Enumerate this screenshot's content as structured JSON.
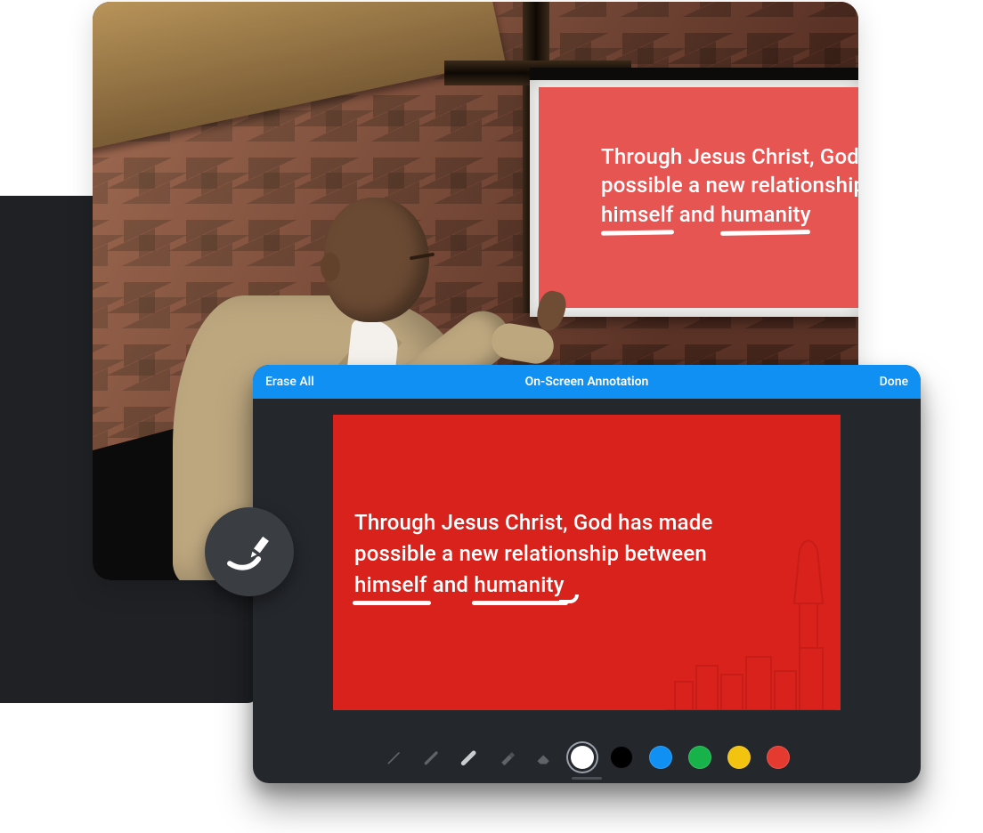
{
  "photo": {
    "projection_text_line1": "Through Jesus Christ, God has",
    "projection_text_line2": "possible a new relationship be",
    "projection_underlined_1": "himself",
    "projection_text_line3_mid": " and ",
    "projection_underlined_2": "humanity"
  },
  "annotation_badge": {
    "icon": "marker-stroke-icon"
  },
  "app": {
    "titlebar": {
      "erase_label": "Erase All",
      "title": "On-Screen Annotation",
      "done_label": "Done"
    },
    "slide": {
      "line1": "Through Jesus Christ, God has made",
      "line2": "possible a new relationship between",
      "underlined_1": "himself",
      "line3_mid": " and ",
      "underlined_2": "humanity"
    },
    "toolbar": {
      "tools": [
        {
          "name": "pen-thin-icon",
          "dim": true
        },
        {
          "name": "pen-medium-icon",
          "dim": true
        },
        {
          "name": "pen-bold-icon",
          "dim": false
        },
        {
          "name": "marker-icon",
          "dim": true
        },
        {
          "name": "eraser-icon",
          "dim": true
        }
      ],
      "colors": [
        {
          "name": "white",
          "hex": "#ffffff",
          "selected": true
        },
        {
          "name": "black",
          "hex": "#000000",
          "selected": false
        },
        {
          "name": "blue",
          "hex": "#0f90f2",
          "selected": false
        },
        {
          "name": "green",
          "hex": "#17b24a",
          "selected": false
        },
        {
          "name": "yellow",
          "hex": "#f2c40f",
          "selected": false
        },
        {
          "name": "red",
          "hex": "#e53a2f",
          "selected": false
        }
      ]
    }
  }
}
